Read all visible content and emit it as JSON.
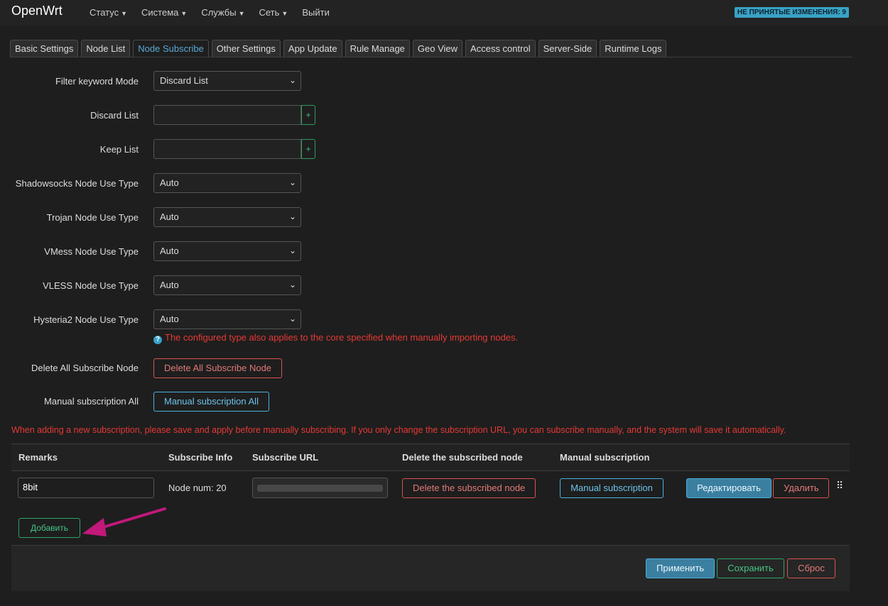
{
  "header": {
    "brand": "OpenWrt",
    "menu": [
      {
        "label": "Статус",
        "caret": true
      },
      {
        "label": "Система",
        "caret": true
      },
      {
        "label": "Службы",
        "caret": true
      },
      {
        "label": "Сеть",
        "caret": true
      },
      {
        "label": "Выйти",
        "caret": false
      }
    ],
    "changes_badge": "НЕ ПРИНЯТЫЕ ИЗМЕНЕНИЯ: 9"
  },
  "tabs": [
    {
      "label": "Basic Settings",
      "active": false
    },
    {
      "label": "Node List",
      "active": false
    },
    {
      "label": "Node Subscribe",
      "active": true
    },
    {
      "label": "Other Settings",
      "active": false
    },
    {
      "label": "App Update",
      "active": false
    },
    {
      "label": "Rule Manage",
      "active": false
    },
    {
      "label": "Geo View",
      "active": false
    },
    {
      "label": "Access control",
      "active": false
    },
    {
      "label": "Server-Side",
      "active": false
    },
    {
      "label": "Runtime Logs",
      "active": false
    }
  ],
  "form": {
    "filter_mode": {
      "label": "Filter keyword Mode",
      "value": "Discard List"
    },
    "discard_list": {
      "label": "Discard List",
      "value": "",
      "add": "+"
    },
    "keep_list": {
      "label": "Keep List",
      "value": "",
      "add": "+"
    },
    "ss_type": {
      "label": "Shadowsocks Node Use Type",
      "value": "Auto"
    },
    "trojan_type": {
      "label": "Trojan Node Use Type",
      "value": "Auto"
    },
    "vmess_type": {
      "label": "VMess Node Use Type",
      "value": "Auto"
    },
    "vless_type": {
      "label": "VLESS Node Use Type",
      "value": "Auto"
    },
    "hy2_type": {
      "label": "Hysteria2 Node Use Type",
      "value": "Auto"
    },
    "hint": "The configured type also applies to the core specified when manually importing nodes.",
    "delete_all": {
      "label": "Delete All Subscribe Node",
      "button": "Delete All Subscribe Node"
    },
    "manual_all": {
      "label": "Manual subscription All",
      "button": "Manual subscription All"
    }
  },
  "warning": "When adding a new subscription, please save and apply before manually subscribing. If you only change the subscription URL, you can subscribe manually, and the system will save it automatically.",
  "table": {
    "headers": {
      "remarks": "Remarks",
      "info": "Subscribe Info",
      "url": "Subscribe URL",
      "delete": "Delete the subscribed node",
      "manual": "Manual subscription"
    },
    "rows": [
      {
        "remarks": "8bit",
        "info": "Node num: 20",
        "url": "",
        "delete_btn": "Delete the subscribed node",
        "manual_btn": "Manual subscription",
        "edit_btn": "Редактировать",
        "remove_btn": "Удалить"
      }
    ],
    "add_btn": "Добавить"
  },
  "footer": {
    "apply": "Применить",
    "save": "Сохранить",
    "reset": "Сброс"
  },
  "colors": {
    "accent_blue": "#4ab3dd",
    "danger_red": "#d9534f",
    "success_green": "#2ea36b",
    "annotation_arrow": "#c2187a"
  }
}
